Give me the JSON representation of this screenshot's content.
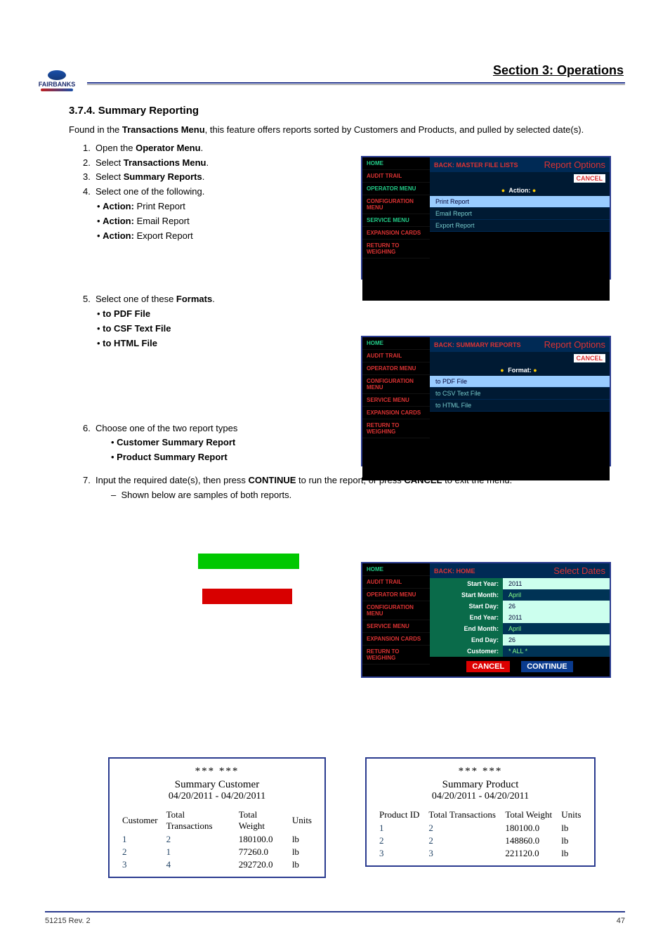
{
  "header": {
    "section_title": "Section 3: Operations",
    "logo_text": "FAIRBANKS"
  },
  "section": {
    "heading": "3.7.4. Summary Reporting",
    "p1_a": "Found in the ",
    "p1_b": "Transactions Menu",
    "p1_c": ", this feature offers reports sorted by Customers and Products, and pulled by selected date(s)."
  },
  "steps": {
    "s1": {
      "n": "1.",
      "a": "Open the ",
      "b": "Operator Menu",
      "c": "."
    },
    "s2": {
      "n": "2.",
      "a": "Select ",
      "b": "Transactions Menu",
      "c": "."
    },
    "s3": {
      "n": "3.",
      "a": "Select ",
      "b": "Summary Reports",
      "c": "."
    },
    "s4": {
      "n": "4.",
      "t": "Select one of the following."
    },
    "b1": {
      "a": "Action: ",
      "b": "Print Report"
    },
    "b2": {
      "a": "Action: ",
      "b": "Email Report"
    },
    "b3": {
      "a": "Action: ",
      "b": "Export Report"
    },
    "s5": {
      "n": "5.",
      "a": "Select one of these ",
      "b": "Formats",
      "c": "."
    },
    "d1": "to PDF File",
    "d2": "to CSF Text File",
    "d3": "to HTML File",
    "s6": {
      "n": "6.",
      "t": "Choose one of the two report types"
    },
    "r1": "Customer Summary Report",
    "r2": "Product Summary Report",
    "s7": {
      "n": "7.",
      "a": "Input the required date(s), then press ",
      "b1": "CONTINUE",
      "mid": " to run the report, or press ",
      "b2": "CANCEL",
      "end": " to exit the menu."
    },
    "dash": "Shown below are samples of both reports."
  },
  "term1": {
    "back": "BACK: MASTER FILE LISTS",
    "title": "Report Options",
    "cancel": "CANCEL",
    "bar2": "Action:",
    "opts": [
      "Print Report",
      "Email Report",
      "Export Report"
    ],
    "side": [
      "HOME",
      "AUDIT TRAIL",
      "OPERATOR MENU",
      "CONFIGURATION MENU",
      "SERVICE MENU",
      "EXPANSION CARDS",
      "RETURN TO WEIGHING"
    ]
  },
  "term2": {
    "back": "BACK: SUMMARY REPORTS",
    "title": "Report Options",
    "cancel": "CANCEL",
    "bar2": "Format:",
    "opts": [
      "to PDF File",
      "to CSV Text File",
      "to HTML File"
    ],
    "side": [
      "HOME",
      "AUDIT TRAIL",
      "OPERATOR MENU",
      "CONFIGURATION MENU",
      "SERVICE MENU",
      "EXPANSION CARDS",
      "RETURN TO WEIGHING"
    ]
  },
  "term3": {
    "back": "BACK: HOME",
    "title": "Select Dates",
    "side": [
      "HOME",
      "AUDIT TRAIL",
      "OPERATOR MENU",
      "CONFIGURATION MENU",
      "SERVICE MENU",
      "EXPANSION CARDS",
      "RETURN TO WEIGHING"
    ],
    "rows": [
      {
        "l": "Start Year:",
        "v": "2011",
        "inv": true
      },
      {
        "l": "Start Month:",
        "v": "April"
      },
      {
        "l": "Start Day:",
        "v": "26",
        "inv": true
      },
      {
        "l": "End Year:",
        "v": "2011",
        "inv": true
      },
      {
        "l": "End Month:",
        "v": "April"
      },
      {
        "l": "End Day:",
        "v": "26",
        "inv": true
      },
      {
        "l": "Customer:",
        "v": "* ALL *"
      }
    ],
    "cancel": "CANCEL",
    "continue": "CONTINUE"
  },
  "card_customer": {
    "stars": "***   ***",
    "t1": "Summary Customer",
    "t2": "04/20/2011 - 04/20/2011",
    "hdr": [
      "Customer",
      "Total Transactions",
      "Total Weight",
      "Units"
    ],
    "rows": [
      [
        "1",
        "2",
        "180100.0",
        "lb"
      ],
      [
        "2",
        "1",
        "77260.0",
        "lb"
      ],
      [
        "3",
        "4",
        "292720.0",
        "lb"
      ]
    ]
  },
  "card_product": {
    "stars": "***   ***",
    "t1": "Summary Product",
    "t2": "04/20/2011 - 04/20/2011",
    "hdr": [
      "Product ID",
      "Total Transactions",
      "Total Weight",
      "Units"
    ],
    "rows": [
      [
        "1",
        "2",
        "180100.0",
        "lb"
      ],
      [
        "2",
        "2",
        "148860.0",
        "lb"
      ],
      [
        "3",
        "3",
        "221120.0",
        "lb"
      ]
    ]
  },
  "footer": {
    "left": "51215 Rev. 2",
    "right": "47"
  }
}
